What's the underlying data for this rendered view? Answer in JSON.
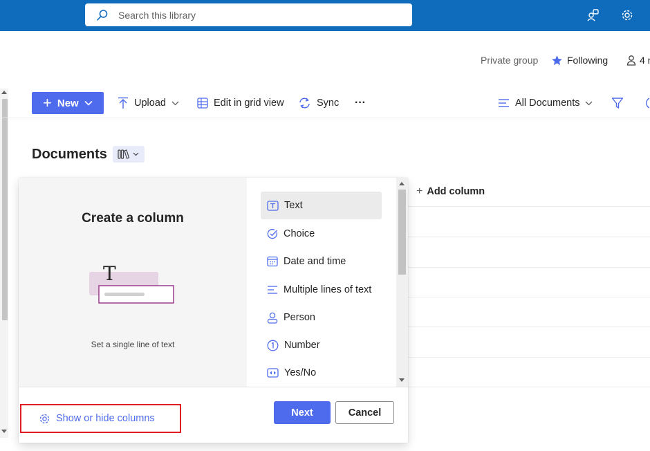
{
  "topbar": {
    "search_placeholder": "Search this library",
    "icons": [
      "search-icon",
      "share-app-icon",
      "gear-icon"
    ]
  },
  "group": {
    "privacy": "Private group",
    "following": "Following",
    "members": "4 m"
  },
  "commands": {
    "new": "New",
    "upload": "Upload",
    "edit_grid": "Edit in grid view",
    "sync": "Sync",
    "more": "···",
    "view": "All Documents"
  },
  "library": {
    "title": "Documents",
    "add_column": "Add column"
  },
  "create_column": {
    "title": "Create a column",
    "description": "Set a single line of text",
    "illustration_glyph": "T",
    "types": [
      {
        "label": "Text",
        "icon": "text-field-icon",
        "selected": true
      },
      {
        "label": "Choice",
        "icon": "choice-check-icon",
        "selected": false
      },
      {
        "label": "Date and time",
        "icon": "calendar-icon",
        "selected": false
      },
      {
        "label": "Multiple lines of text",
        "icon": "multiline-text-icon",
        "selected": false
      },
      {
        "label": "Person",
        "icon": "person-icon",
        "selected": false
      },
      {
        "label": "Number",
        "icon": "number-icon",
        "selected": false
      },
      {
        "label": "Yes/No",
        "icon": "yes-no-icon",
        "selected": false
      }
    ],
    "show_hide": "Show or hide columns",
    "next": "Next",
    "cancel": "Cancel"
  },
  "colors": {
    "suite_bar": "#0f6cbd",
    "accent": "#4f6bed",
    "highlight_border": "#e02020"
  }
}
